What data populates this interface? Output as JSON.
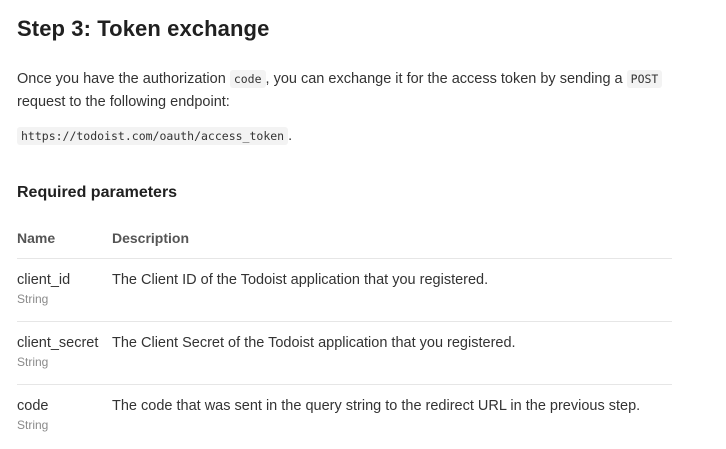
{
  "step": {
    "title": "Step 3: Token exchange"
  },
  "intro": {
    "text_before_code": "Once you have the authorization ",
    "code_1": "code",
    "text_middle": ", you can exchange it for the access token by sending a ",
    "code_2": "POST",
    "text_after": " request to the following endpoint:"
  },
  "endpoint": {
    "url": "https://todoist.com/oauth/access_token",
    "suffix": "."
  },
  "required_parameters": {
    "title": "Required parameters",
    "columns": {
      "name": "Name",
      "description": "Description"
    },
    "rows": [
      {
        "name": "client_id",
        "type": "String",
        "description": "The Client ID of the Todoist application that you registered."
      },
      {
        "name": "client_secret",
        "type": "String",
        "description": "The Client Secret of the Todoist application that you registered."
      },
      {
        "name": "code",
        "type": "String",
        "description": "The code that was sent in the query string to the redirect URL in the previous step."
      }
    ]
  }
}
